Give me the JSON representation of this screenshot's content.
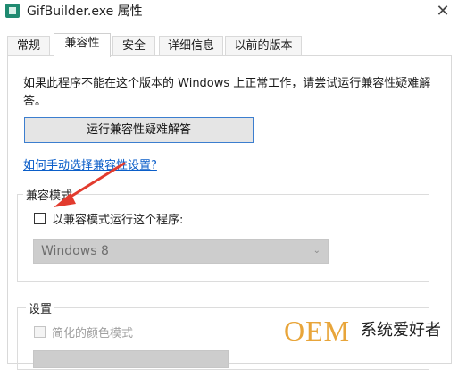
{
  "window": {
    "title": "GifBuilder.exe 属性",
    "close_glyph": "✕"
  },
  "tabs": [
    {
      "label": "常规"
    },
    {
      "label": "兼容性"
    },
    {
      "label": "安全"
    },
    {
      "label": "详细信息"
    },
    {
      "label": "以前的版本"
    }
  ],
  "active_tab": "兼容性",
  "compat": {
    "description": "如果此程序不能在这个版本的 Windows 上正常工作，请尝试运行兼容性疑难解答。",
    "troubleshoot_button": "运行兼容性疑难解答",
    "manual_link": "如何手动选择兼容性设置?",
    "mode_group": {
      "legend": "兼容模式",
      "checkbox_label": "以兼容模式运行这个程序:",
      "checkbox_checked": false,
      "os_select_value": "Windows 8"
    },
    "settings_group": {
      "legend": "设置",
      "color_mode_label": "简化的颜色模式",
      "color_mode_checked": false
    }
  },
  "watermark": {
    "brand": "OEM",
    "text": "系统爱好者"
  },
  "colors": {
    "accent": "#3c7ecf",
    "link": "#0b5ec9",
    "arrow": "#e23b2e",
    "watermark": "#e8a53a"
  }
}
